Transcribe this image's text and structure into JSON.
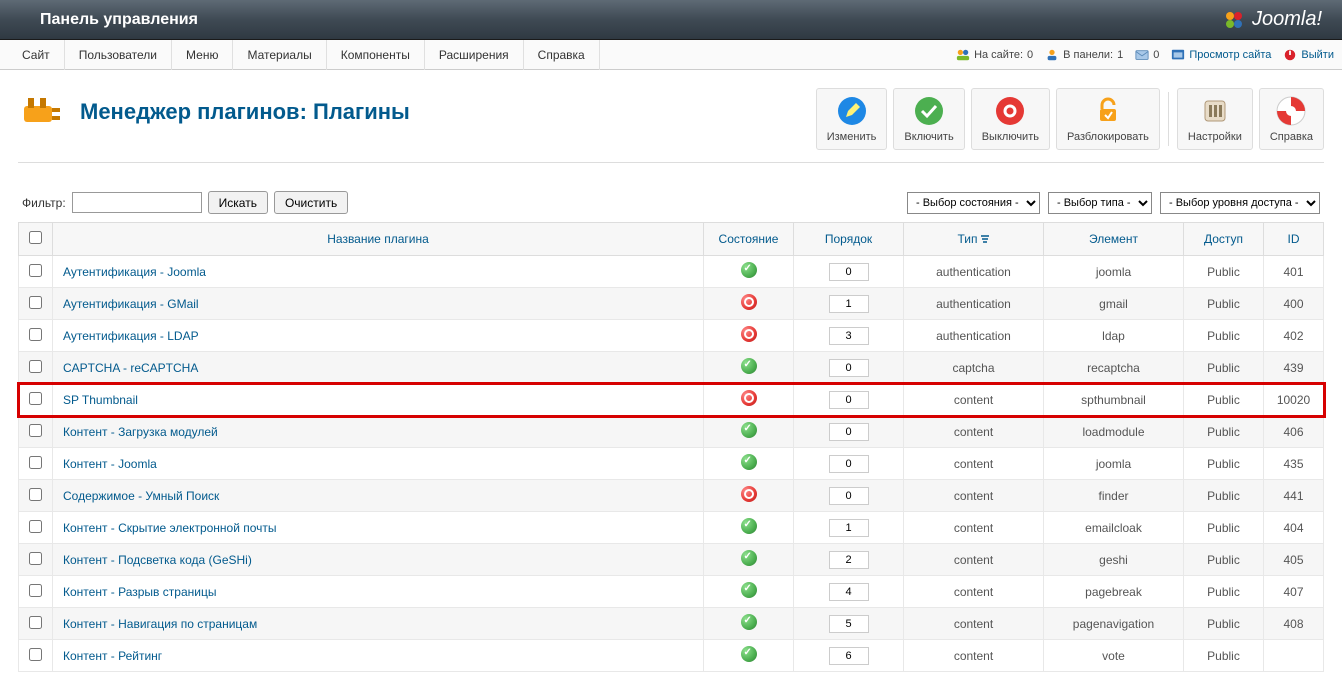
{
  "header": {
    "title": "Панель управления",
    "brand": "Joomla!"
  },
  "menubar": {
    "items": [
      "Сайт",
      "Пользователи",
      "Меню",
      "Материалы",
      "Компоненты",
      "Расширения",
      "Справка"
    ],
    "status": {
      "visitors_label": "На сайте:",
      "visitors": "0",
      "admins_label": "В панели:",
      "admins": "1",
      "messages": "0",
      "view_site": "Просмотр сайта",
      "logout": "Выйти"
    }
  },
  "page": {
    "title": "Менеджер плагинов: Плагины"
  },
  "toolbar": {
    "edit": "Изменить",
    "enable": "Включить",
    "disable": "Выключить",
    "unlock": "Разблокировать",
    "options": "Настройки",
    "help": "Справка"
  },
  "filter": {
    "label": "Фильтр:",
    "value": "",
    "search": "Искать",
    "clear": "Очистить",
    "state_placeholder": "- Выбор состояния -",
    "type_placeholder": "- Выбор типа -",
    "access_placeholder": "- Выбор уровня доступа -"
  },
  "table": {
    "headers": {
      "name": "Название плагина",
      "state": "Состояние",
      "order": "Порядок",
      "type": "Тип",
      "element": "Элемент",
      "access": "Доступ",
      "id": "ID"
    },
    "rows": [
      {
        "name": "Аутентификация - Joomla",
        "state": "on",
        "order": "0",
        "type": "authentication",
        "element": "joomla",
        "access": "Public",
        "id": "401",
        "highlight": false
      },
      {
        "name": "Аутентификация - GMail",
        "state": "off",
        "order": "1",
        "type": "authentication",
        "element": "gmail",
        "access": "Public",
        "id": "400",
        "highlight": false
      },
      {
        "name": "Аутентификация - LDAP",
        "state": "off",
        "order": "3",
        "type": "authentication",
        "element": "ldap",
        "access": "Public",
        "id": "402",
        "highlight": false
      },
      {
        "name": "CAPTCHA - reCAPTCHA",
        "state": "on",
        "order": "0",
        "type": "captcha",
        "element": "recaptcha",
        "access": "Public",
        "id": "439",
        "highlight": false
      },
      {
        "name": "SP Thumbnail",
        "state": "off",
        "order": "0",
        "type": "content",
        "element": "spthumbnail",
        "access": "Public",
        "id": "10020",
        "highlight": true
      },
      {
        "name": "Контент - Загрузка модулей",
        "state": "on",
        "order": "0",
        "type": "content",
        "element": "loadmodule",
        "access": "Public",
        "id": "406",
        "highlight": false
      },
      {
        "name": "Контент - Joomla",
        "state": "on",
        "order": "0",
        "type": "content",
        "element": "joomla",
        "access": "Public",
        "id": "435",
        "highlight": false
      },
      {
        "name": "Содержимое - Умный Поиск",
        "state": "off",
        "order": "0",
        "type": "content",
        "element": "finder",
        "access": "Public",
        "id": "441",
        "highlight": false
      },
      {
        "name": "Контент - Скрытие электронной почты",
        "state": "on",
        "order": "1",
        "type": "content",
        "element": "emailcloak",
        "access": "Public",
        "id": "404",
        "highlight": false
      },
      {
        "name": "Контент - Подсветка кода (GeSHi)",
        "state": "on",
        "order": "2",
        "type": "content",
        "element": "geshi",
        "access": "Public",
        "id": "405",
        "highlight": false
      },
      {
        "name": "Контент - Разрыв страницы",
        "state": "on",
        "order": "4",
        "type": "content",
        "element": "pagebreak",
        "access": "Public",
        "id": "407",
        "highlight": false
      },
      {
        "name": "Контент - Навигация по страницам",
        "state": "on",
        "order": "5",
        "type": "content",
        "element": "pagenavigation",
        "access": "Public",
        "id": "408",
        "highlight": false
      },
      {
        "name": "Контент - Рейтинг",
        "state": "on",
        "order": "6",
        "type": "content",
        "element": "vote",
        "access": "Public",
        "id": "",
        "highlight": false
      }
    ]
  }
}
